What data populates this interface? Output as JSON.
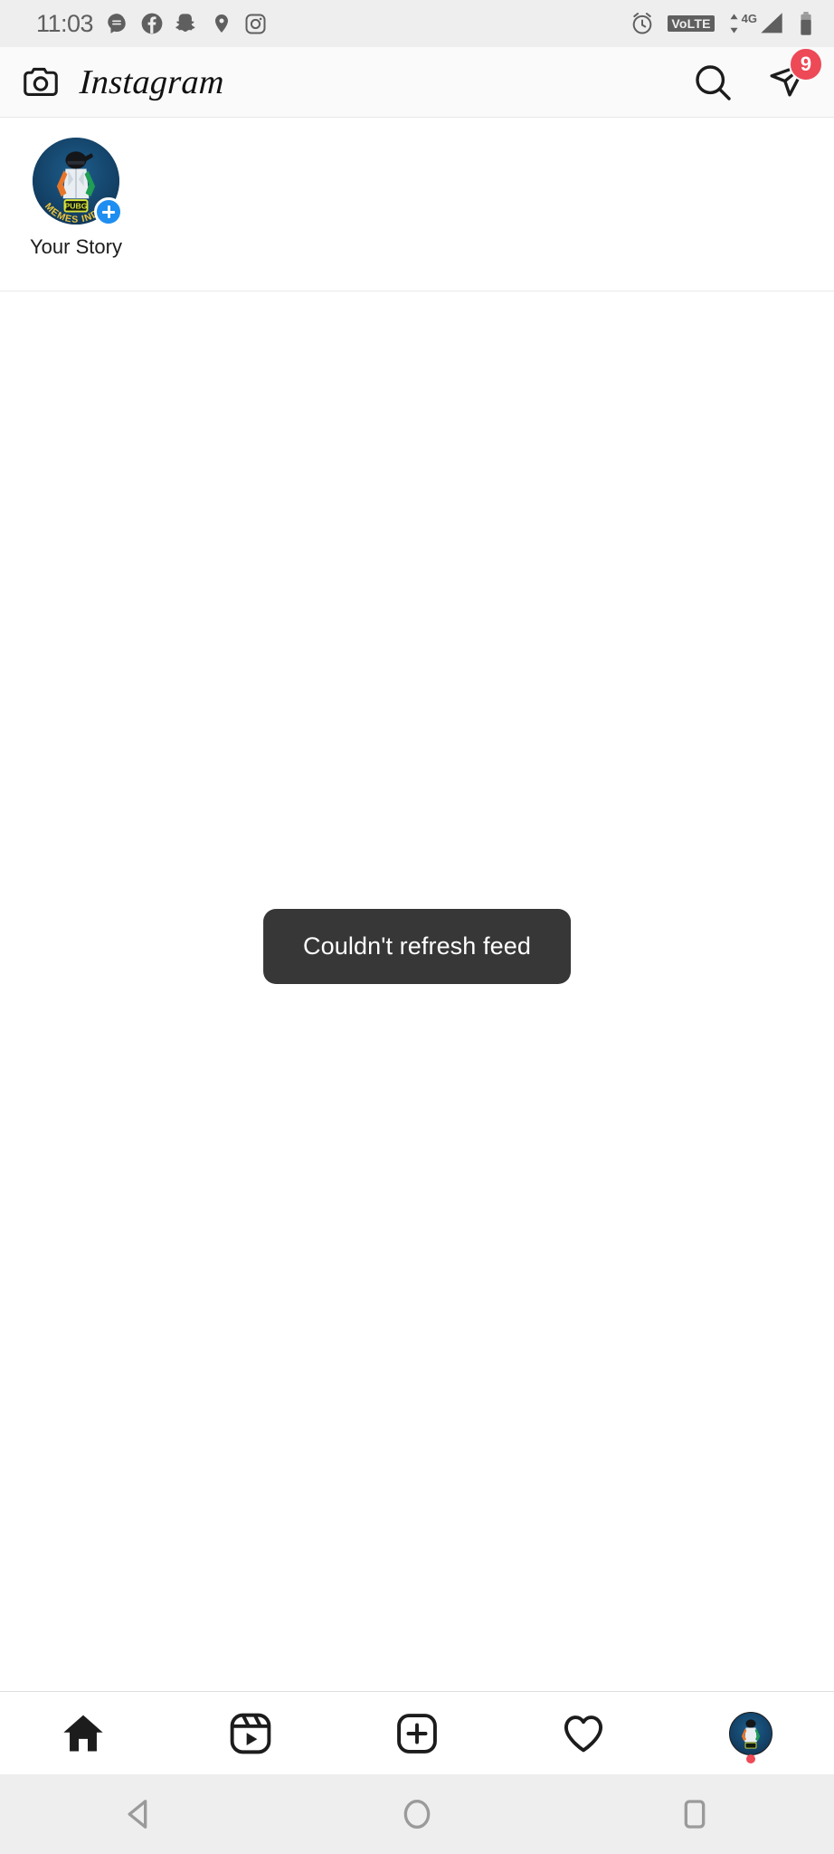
{
  "status_bar": {
    "time": "11:03",
    "left_icons": [
      "messenger-chat-icon",
      "facebook-icon",
      "snapchat-icon",
      "location-pin-icon",
      "instagram-icon"
    ],
    "alarm_icon": "alarm-clock-icon",
    "volte_label": "VoLTE",
    "network_label": "4G",
    "network_superscript": "+",
    "signal_icon": "signal-bars-icon",
    "battery_icon": "battery-icon",
    "icon_color": "#5f5f5f",
    "background": "#eeeeee"
  },
  "header": {
    "camera_icon": "camera-icon",
    "title": "Instagram",
    "search_icon": "search-icon",
    "messenger_icon": "direct-messenger-icon",
    "badge_count": "9",
    "badge_color": "#ed4956",
    "background": "#fafafa"
  },
  "stories": [
    {
      "label": "Your Story",
      "avatar_name": "pubg-memes-india-avatar",
      "avatar_text_top": "PUBG",
      "avatar_text_bottom": "MEMES INDIA",
      "has_add_badge": true,
      "badge_color": "#1f8ef1"
    }
  ],
  "feed": {
    "toast_message": "Couldn't refresh feed",
    "toast_background": "#373737",
    "toast_text_color": "#ffffff",
    "empty": true
  },
  "tab_bar": {
    "tabs": [
      {
        "name": "home-tab",
        "icon": "home-icon",
        "active": true
      },
      {
        "name": "reels-tab",
        "icon": "reels-icon",
        "active": false
      },
      {
        "name": "create-tab",
        "icon": "plus-square-icon",
        "active": false
      },
      {
        "name": "activity-tab",
        "icon": "heart-icon",
        "active": false
      },
      {
        "name": "profile-tab",
        "icon": "profile-avatar-icon",
        "active": false,
        "has_notification_dot": true
      }
    ]
  },
  "android_nav": {
    "back": "back-triangle-icon",
    "home": "home-circle-icon",
    "recents": "recents-square-icon",
    "icon_color": "#9a9a9a",
    "background": "#eeeeee"
  }
}
